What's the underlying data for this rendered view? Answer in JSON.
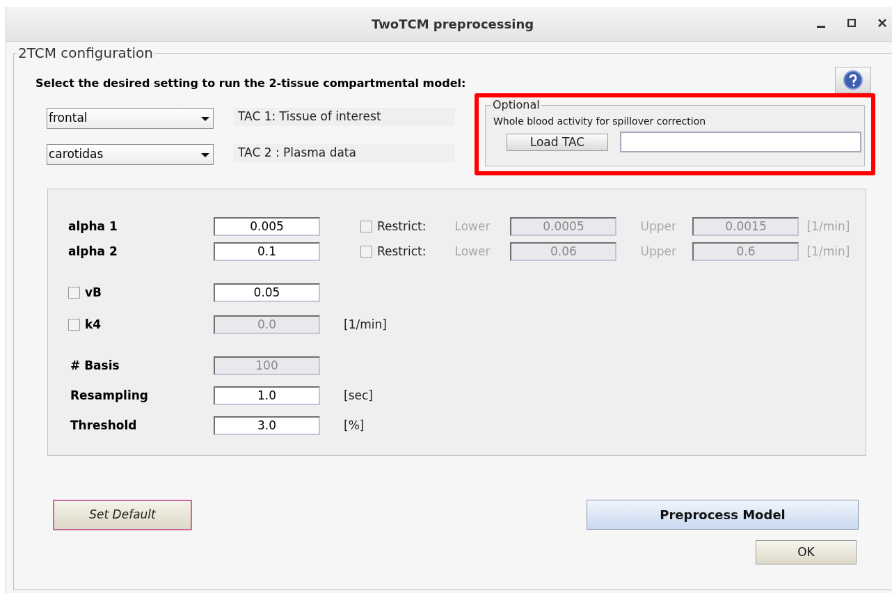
{
  "window": {
    "title": "TwoTCM preprocessing"
  },
  "config": {
    "legend": "2TCM configuration",
    "instruction": "Select the desired setting to run the 2-tissue compartmental model:"
  },
  "tacs": [
    {
      "value": "frontal",
      "label": "TAC 1: Tissue of interest"
    },
    {
      "value": "carotidas",
      "label": "TAC 2 : Plasma data"
    }
  ],
  "optional": {
    "legend": "Optional",
    "description": "Whole blood activity for spillover correction",
    "button": "Load TAC",
    "highlighted": true
  },
  "parameters": [
    {
      "kind": "restrictable",
      "label": "alpha 1",
      "value": "0.005",
      "restrict": {
        "label": "Restrict:",
        "checked": false
      },
      "lower": {
        "label": "Lower",
        "value": "0.0005"
      },
      "upper": {
        "label": "Upper",
        "value": "0.0015"
      },
      "unit": "[1/min]"
    },
    {
      "kind": "restrictable",
      "label": "alpha 2",
      "value": "0.1",
      "restrict": {
        "label": "Restrict:",
        "checked": false
      },
      "lower": {
        "label": "Lower",
        "value": "0.06"
      },
      "upper": {
        "label": "Upper",
        "value": "0.6"
      },
      "unit": "[1/min]"
    },
    {
      "kind": "toggle",
      "label": "vB",
      "checked": false,
      "value": "0.05",
      "disabled": false
    },
    {
      "kind": "toggle",
      "label": "k4",
      "checked": false,
      "value": "0.0",
      "disabled": true,
      "unit": "[1/min]"
    },
    {
      "kind": "plain",
      "label": "# Basis",
      "value": "100",
      "disabled": true
    },
    {
      "kind": "plain",
      "label": "Resampling",
      "value": "1.0",
      "disabled": false,
      "unit": "[sec]"
    },
    {
      "kind": "plain",
      "label": "Threshold",
      "value": "3.0",
      "disabled": false,
      "unit": "[%]"
    }
  ],
  "buttons": {
    "set_default": "Set Default",
    "preprocess": "Preprocess Model",
    "ok": "OK"
  }
}
